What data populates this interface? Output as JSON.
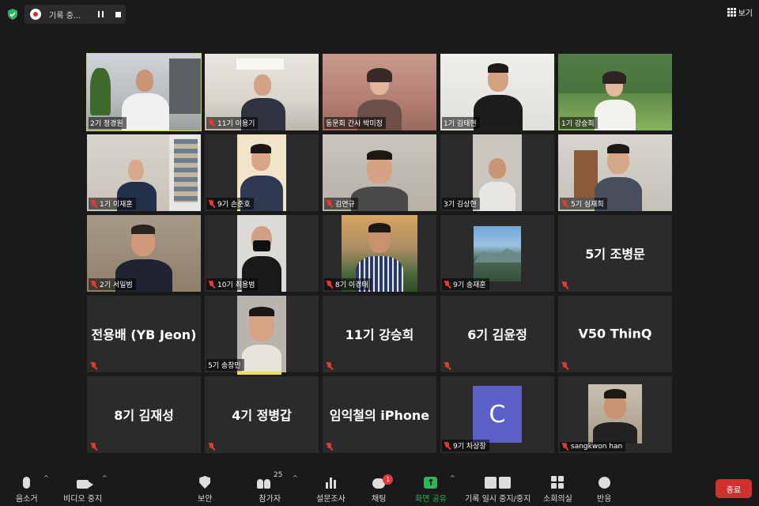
{
  "meeting": {
    "recording_label": "기록 중...",
    "view_label": "보기",
    "colors": {
      "security_shield": "#2db55d",
      "active_speaker_border": "#c9d86a",
      "muted_mic": "#e53935",
      "end_button": "#d32f2f",
      "share_green": "#2db55d"
    }
  },
  "participants": [
    {
      "name": "2기 정경원",
      "has_video": true,
      "muted": false,
      "active_speaker": true
    },
    {
      "name": "11기 이용기",
      "has_video": true,
      "muted": true
    },
    {
      "name": "동문회 간사 박미정",
      "has_video": true,
      "muted": false
    },
    {
      "name": "1기 김태현",
      "has_video": true,
      "muted": false
    },
    {
      "name": "1기 강승희",
      "has_video": true,
      "muted": false
    },
    {
      "name": "1기 이재훈",
      "has_video": true,
      "muted": true
    },
    {
      "name": "9기 손준호",
      "has_video": true,
      "muted": true
    },
    {
      "name": "김연규",
      "has_video": true,
      "muted": true
    },
    {
      "name": "3기 김상현",
      "has_video": true,
      "muted": false
    },
    {
      "name": "5기 심재희",
      "has_video": true,
      "muted": true
    },
    {
      "name": "2기 서일범",
      "has_video": true,
      "muted": true
    },
    {
      "name": "10기 최용범",
      "has_video": true,
      "muted": true
    },
    {
      "name": "8기 이경태",
      "has_video": true,
      "muted": true
    },
    {
      "name": "9기 송재훈",
      "has_video": true,
      "muted": true
    },
    {
      "name": "5기 조병문",
      "has_video": false,
      "muted": true
    },
    {
      "name": "전용배 (YB Jeon)",
      "has_video": false,
      "muted": true
    },
    {
      "name": "5기 송창민",
      "has_video": true,
      "muted": false
    },
    {
      "name": "11기 강승희",
      "has_video": false,
      "muted": true
    },
    {
      "name": "6기 김윤정",
      "has_video": false,
      "muted": true
    },
    {
      "name": "V50 ThinQ",
      "has_video": false,
      "muted": true
    },
    {
      "name": "8기 김재성",
      "has_video": false,
      "muted": true
    },
    {
      "name": "4기 정병갑",
      "has_video": false,
      "muted": true
    },
    {
      "name": "임익철의 iPhone",
      "has_video": false,
      "muted": true
    },
    {
      "name": "9기 차상창",
      "has_video": false,
      "muted": true,
      "avatar_letter": "C"
    },
    {
      "name": "sangkwon han",
      "has_video": true,
      "muted": true
    }
  ],
  "toolbar": {
    "mute_label": "음소거",
    "video_label": "비디오 중지",
    "security_label": "보안",
    "participants_label": "참가자",
    "participants_count": "25",
    "polls_label": "설문조사",
    "chat_label": "채팅",
    "chat_badge": "1",
    "share_label": "화면 공유",
    "recording_label": "기록 일시 중지/중지",
    "breakout_label": "소회의실",
    "reactions_label": "반응",
    "end_label": "종료"
  }
}
